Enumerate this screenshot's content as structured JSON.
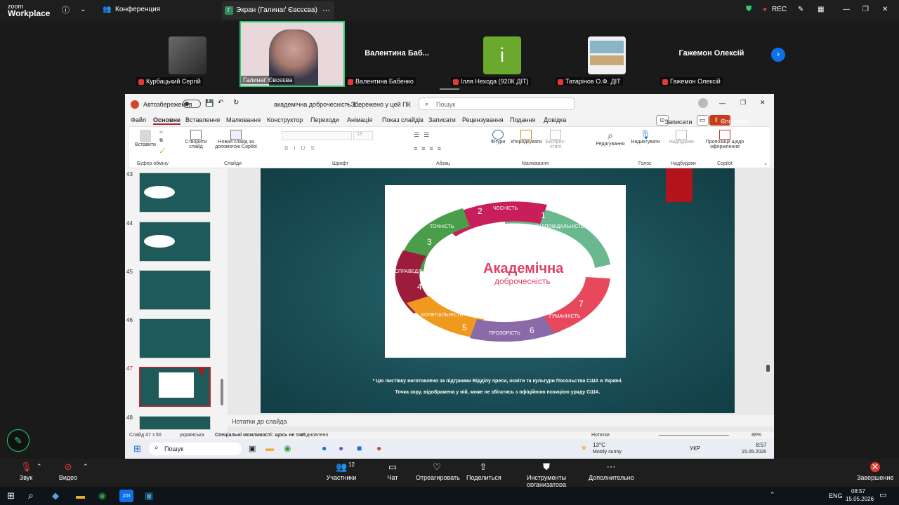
{
  "zoom": {
    "logo_top": "zoom",
    "logo_bottom": "Workplace",
    "conference": "Конференция",
    "screen_tab": "Экран (Галинаґ Євсєєва)",
    "rec": "REC"
  },
  "participants": [
    {
      "label": "Курбацький Сергій"
    },
    {
      "label": "Галинаґ Євсєєва"
    },
    {
      "name": "Валентина  Баб...",
      "label": "Валентина Бабенко"
    },
    {
      "avatar": "і",
      "label": "Ілля Нехода (920К ДІТ)"
    },
    {
      "label": "Татарінов О.Ф. ДІТ"
    },
    {
      "name": "Гажемон Олексій",
      "label": "Гажемон Олексій"
    }
  ],
  "pp": {
    "autosave": "Автозбереження",
    "doc": "академічна доброчесність 1...",
    "saved": "• Збережено у цей ПК",
    "search": "Пошук",
    "record": "Записати",
    "share": "Спільний доступ",
    "menu": [
      "Файл",
      "Основне",
      "Вставлення",
      "Малювання",
      "Конструктор",
      "Переходи",
      "Анімація",
      "Показ слайдів",
      "Записати",
      "Рецензування",
      "Подання",
      "Довідка"
    ],
    "ribbon": {
      "paste": "Вставити",
      "clipboard": "Буфер обміну",
      "new_slide": "Створити слайд",
      "copilot_slide": "Новий слайд за допомогою Copilot",
      "slides": "Слайди",
      "font_size": "18",
      "font": "Шрифт",
      "para": "Абзац",
      "shapes": "Фігури",
      "arrange": "Упорядкувати",
      "express": "Експрес-стилі",
      "drawing": "Малювання",
      "edit": "Редагування",
      "dictate": "Надиктувати",
      "voice": "Голос",
      "addins": "Надбудови",
      "addins2": "Надбудови",
      "designer": "Пропозиції щодо оформлення",
      "copilot": "Copilot"
    },
    "thumbs": [
      "43",
      "44",
      "45",
      "46",
      "47",
      "48"
    ],
    "notes": "Нотатки до слайда",
    "status": {
      "slide": "Слайд 47 з 50",
      "lang": "українська",
      "access": "Спеціальні можливості: щось не так",
      "restored": "Відновлено",
      "notes": "Нотатки",
      "zoom": "88%"
    }
  },
  "slide": {
    "title": "Академічна",
    "subtitle": "доброчесність",
    "segments": [
      {
        "n": "1",
        "t": "ВІДПОВІДАЛЬНІСТЬ"
      },
      {
        "n": "2",
        "t": "ЧЕСНІСТЬ"
      },
      {
        "n": "3",
        "t": "ТОЧНІСТЬ"
      },
      {
        "n": "4",
        "t": "СПРАВЕДЛИВІСТЬ"
      },
      {
        "n": "5",
        "t": "КОЛЕГІАЛЬНІСТЬ"
      },
      {
        "n": "6",
        "t": "ПРОЗОРІСТЬ"
      },
      {
        "n": "7",
        "t": "ГУМАННІСТЬ"
      }
    ],
    "disc1": "* Цю листівку виготовлено за підтримки Відділу преси, освіти та культури Посольства США в Україні.",
    "disc2": "Точка зору, відображена у ній, може не збігатись з офіційною позицією уряду США."
  },
  "wintask": {
    "search": "Пошук",
    "temp": "13°C",
    "weather": "Mostly sunny",
    "lang": "УКР",
    "time": "8:57",
    "date": "15.05.2026"
  },
  "controls": {
    "audio": "Звук",
    "video": "Видео",
    "participants": "Участники",
    "count": "12",
    "chat": "Чат",
    "react": "Отреагировать",
    "share": "Поделиться",
    "host": "Инструменты организатора",
    "more": "Дополнительно",
    "end": "Завершение"
  },
  "hosttask": {
    "lang": "ENG",
    "time": "08:57",
    "date": "15.05.2026"
  }
}
